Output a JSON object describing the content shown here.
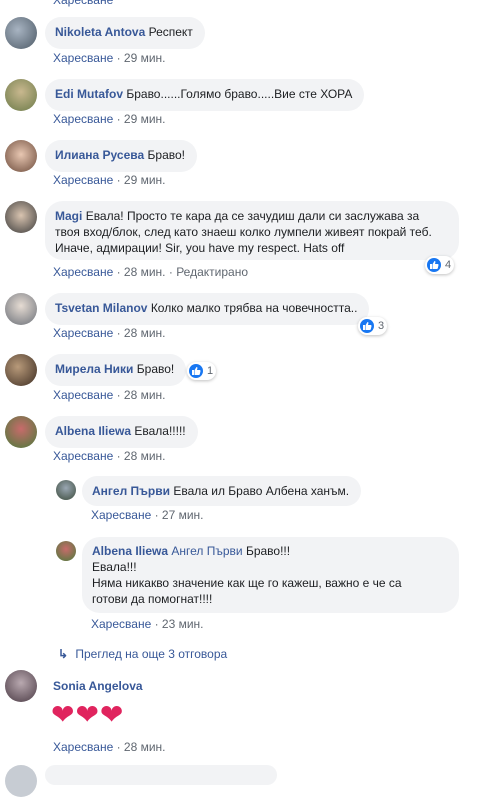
{
  "comments": [
    {
      "name": "Nikoleta Antova",
      "text": "Респект",
      "like": "Харесване",
      "time": "29 мин."
    },
    {
      "name": "Edi Mutafov",
      "text": "Браво......Голямо браво.....Вие сте ХОРА",
      "like": "Харесване",
      "time": "29 мин."
    },
    {
      "name": "Илиана Русева",
      "text": "Браво!",
      "like": "Харесване",
      "time": "29 мин."
    },
    {
      "name": "Magi",
      "text": "Евала! Просто те кара да се зачудиш дали си заслужава за твоя вход/блок, след като знаеш колко лумпели живеят покрай теб. Иначе, адмирации! Sir, you have my respect. Hats off",
      "like": "Харесване",
      "time": "28 мин.",
      "edited": "Редактирано",
      "reactions": "4"
    },
    {
      "name": "Tsvetan Milanov",
      "text": "Колко малко трябва на човечността..",
      "like": "Харесване",
      "time": "28 мин.",
      "reactions": "3"
    },
    {
      "name": "Мирела Ники",
      "text": "Браво!",
      "like": "Харесване",
      "time": "28 мин.",
      "reactions": "1"
    },
    {
      "name": "Albena Iliewa",
      "text": "Евала!!!!!",
      "like": "Харесване",
      "time": "28 мин."
    },
    {
      "name": "Sonia Angelova",
      "text": "",
      "like": "Харесване",
      "time": "28 мин."
    }
  ],
  "replies": [
    {
      "name": "Ангел Първи",
      "text": "Евала ил Браво Албена ханъм.",
      "like": "Харесване",
      "time": "27 мин."
    },
    {
      "name": "Albena Iliewa",
      "mention": "Ангел Първи",
      "text": "Браво!!!",
      "line2": "Евала!!!",
      "line3": "Няма никакво значение как ще го кажеш, важно е че са",
      "line4": "готови да помогнат!!!!",
      "like": "Харесване",
      "time": "23 мин."
    }
  ],
  "view_more": "Преглед на още 3 отговора",
  "hearts": "❤❤❤",
  "colors": {
    "name": "#385898",
    "bubble": "#f2f3f5",
    "meta": "#606770",
    "like": "#1877f2",
    "heart": "#e0245e"
  }
}
